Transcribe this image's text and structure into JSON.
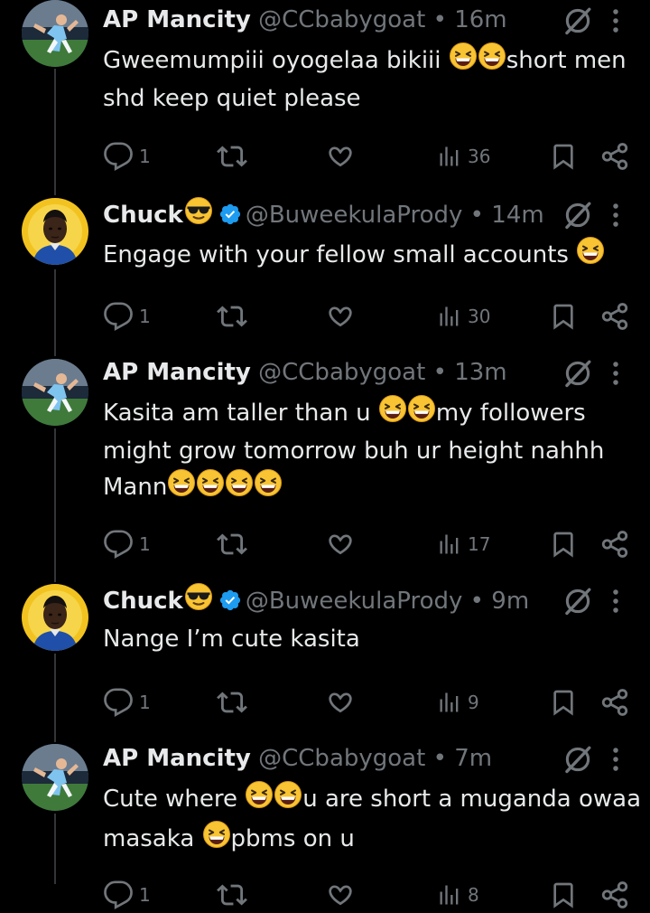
{
  "tweets": [
    {
      "name": "AP Mancity",
      "handle": "@CCbabygoat",
      "time": "16m",
      "verified": false,
      "avatar": "man-city-player-avatar",
      "lines": [
        {
          "parts": [
            {
              "t": "Gweemumpiii oyogelaa bikiii "
            },
            {
              "emoji": 2
            },
            {
              "t": "short men"
            }
          ]
        },
        {
          "parts": [
            {
              "t": "shd keep quiet please"
            }
          ]
        }
      ],
      "replies": "1",
      "views": "36"
    },
    {
      "name": "Chuck",
      "handle": "@BuweekulaPrody",
      "time": "14m",
      "verified": true,
      "avatar": "chuck-portrait-avatar",
      "lines": [
        {
          "parts": [
            {
              "t": "Engage with your fellow small accounts "
            },
            {
              "emoji": 1
            }
          ]
        }
      ],
      "replies": "1",
      "views": "30"
    },
    {
      "name": "AP Mancity",
      "handle": "@CCbabygoat",
      "time": "13m",
      "verified": false,
      "avatar": "man-city-player-avatar",
      "lines": [
        {
          "parts": [
            {
              "t": "Kasita am taller than u "
            },
            {
              "emoji": 2
            },
            {
              "t": "my followers"
            }
          ]
        },
        {
          "parts": [
            {
              "t": "might grow tomorrow buh ur height nahhh"
            }
          ]
        },
        {
          "parts": [
            {
              "t": "Mann"
            },
            {
              "emoji": 4
            }
          ]
        }
      ],
      "replies": "1",
      "views": "17"
    },
    {
      "name": "Chuck",
      "handle": "@BuweekulaPrody",
      "time": "9m",
      "verified": true,
      "avatar": "chuck-portrait-avatar",
      "lines": [
        {
          "parts": [
            {
              "t": "Nange I’m cute kasita"
            }
          ]
        }
      ],
      "replies": "1",
      "views": "9"
    },
    {
      "name": "AP Mancity",
      "handle": "@CCbabygoat",
      "time": "7m",
      "verified": false,
      "avatar": "man-city-player-avatar",
      "lines": [
        {
          "parts": [
            {
              "t": "Cute where "
            },
            {
              "emoji": 2
            },
            {
              "t": "u are short a muganda owaa"
            }
          ]
        },
        {
          "parts": [
            {
              "t": "masaka "
            },
            {
              "emoji": 1
            },
            {
              "t": "pbms on u"
            }
          ]
        }
      ],
      "replies": "1",
      "views": "8"
    }
  ],
  "icons": {
    "reply": "reply-icon",
    "retweet": "retweet-icon",
    "like": "like-icon",
    "views": "views-icon",
    "bookmark": "bookmark-icon",
    "share": "share-icon",
    "grok": "grok-icon",
    "more": "more-icon",
    "verified": "verified-badge-icon",
    "emoji": "grinning-squinting-emoji",
    "sunglasses": "sunglasses-emoji"
  },
  "colors": {
    "background": "#000000",
    "text": "#e7e9ea",
    "muted": "#71767b",
    "verified": "#1d9bf0",
    "thread_line": "#333639"
  }
}
